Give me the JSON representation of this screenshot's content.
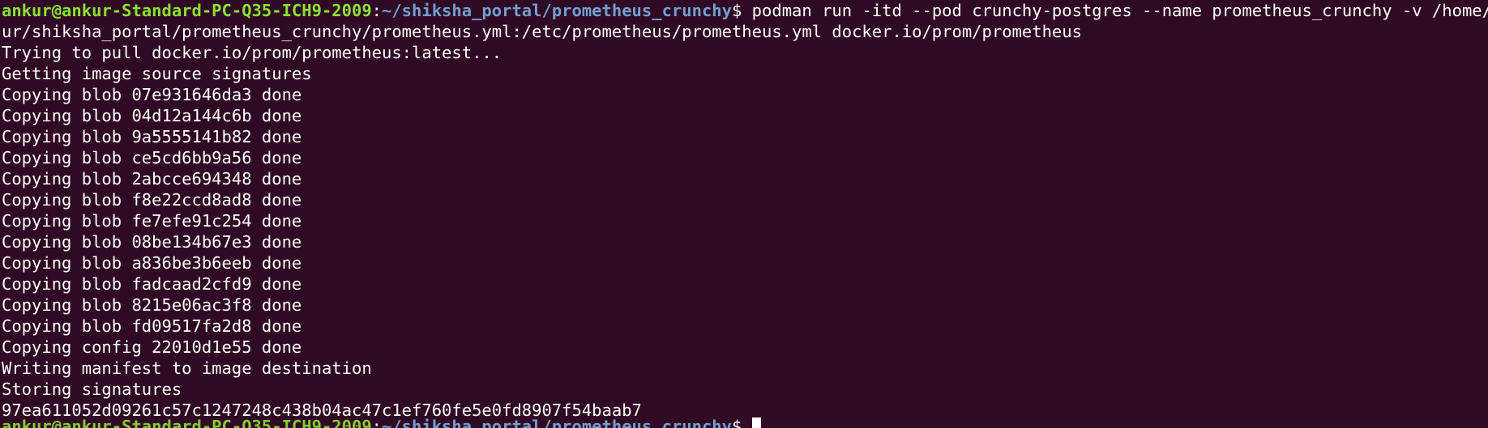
{
  "window": {
    "type": "terminal"
  },
  "colors": {
    "background": "#300a24",
    "prompt_user": "#8ae234",
    "prompt_path": "#729fcf",
    "text": "#ffffff"
  },
  "prompt": {
    "user_host": "ankur@ankur-Standard-PC-Q35-ICH9-2009",
    "separator": ":",
    "path": "~/shiksha_portal/prometheus_crunchy",
    "symbol": "$ "
  },
  "command": {
    "line1": "podman run -itd --pod crunchy-postgres --name prometheus_crunchy -v /home/ank",
    "line2": "ur/shiksha_portal/prometheus_crunchy/prometheus.yml:/etc/prometheus/prometheus.yml docker.io/prom/prometheus"
  },
  "output": [
    "Trying to pull docker.io/prom/prometheus:latest...",
    "Getting image source signatures",
    "Copying blob 07e931646da3 done",
    "Copying blob 04d12a144c6b done",
    "Copying blob 9a5555141b82 done",
    "Copying blob ce5cd6bb9a56 done",
    "Copying blob 2abcce694348 done",
    "Copying blob f8e22ccd8ad8 done",
    "Copying blob fe7efe91c254 done",
    "Copying blob 08be134b67e3 done",
    "Copying blob a836be3b6eeb done",
    "Copying blob fadcaad2cfd9 done",
    "Copying blob 8215e06ac3f8 done",
    "Copying blob fd09517fa2d8 done",
    "Copying config 22010d1e55 done",
    "Writing manifest to image destination",
    "Storing signatures",
    "97ea611052d09261c57c1247248c438b04ac47c1ef760fe5e0fd8907f54baab7"
  ],
  "final_prompt": {
    "user_host": "ankur@ankur-Standard-PC-Q35-ICH9-2009",
    "separator": ":",
    "path": "~/shiksha_portal/prometheus_crunchy",
    "symbol": "$ "
  }
}
